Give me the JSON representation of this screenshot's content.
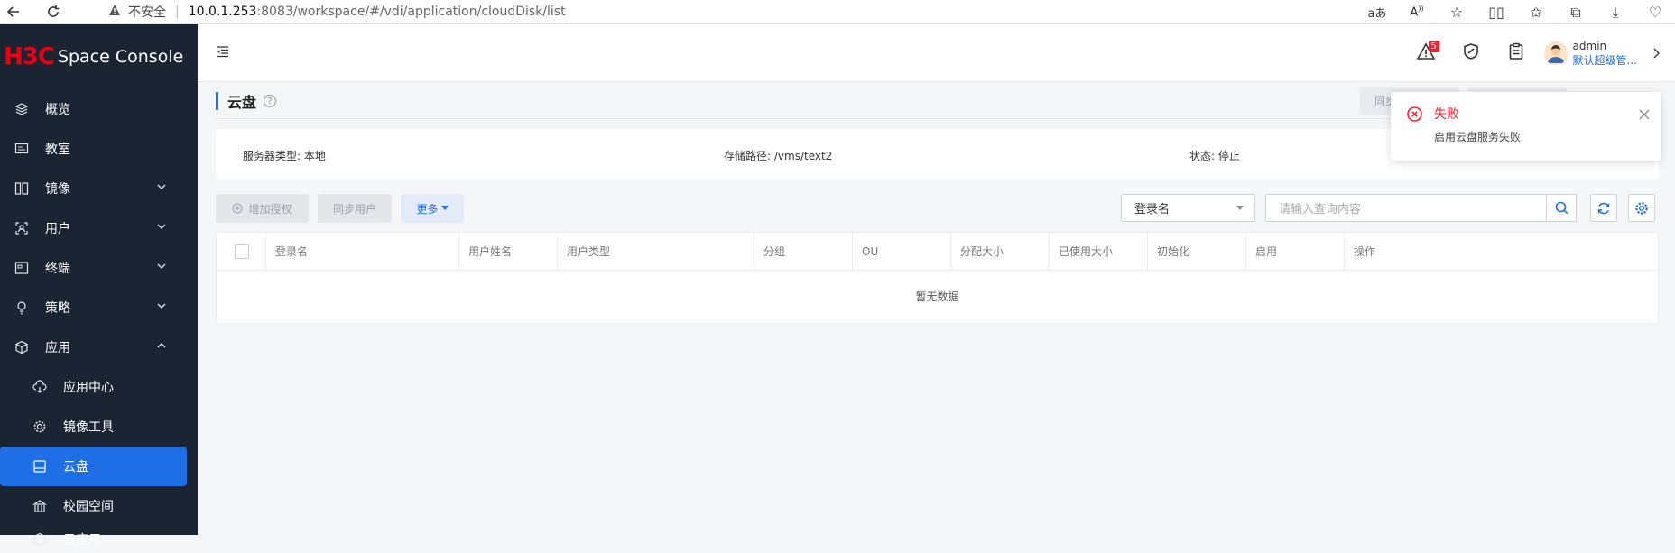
{
  "browser": {
    "insecure_label": "不安全",
    "url_host": "10.0.1.253",
    "url_rest": ":8083/workspace/#/vdi/application/cloudDisk/list"
  },
  "app": {
    "brand": "H3C",
    "title": "Space Console"
  },
  "sidebar": {
    "items": [
      {
        "label": "概览",
        "icon": "layers-icon"
      },
      {
        "label": "教室",
        "icon": "classroom-icon"
      },
      {
        "label": "镜像",
        "icon": "image-icon"
      },
      {
        "label": "用户",
        "icon": "user-icon"
      },
      {
        "label": "终端",
        "icon": "terminal-icon"
      },
      {
        "label": "策略",
        "icon": "policy-icon"
      },
      {
        "label": "应用",
        "icon": "app-icon"
      }
    ],
    "subitems": [
      {
        "label": "应用中心",
        "icon": "app-center-icon"
      },
      {
        "label": "镜像工具",
        "icon": "gear-icon"
      },
      {
        "label": "云盘",
        "icon": "cloud-disk-icon"
      },
      {
        "label": "校园空间",
        "icon": "campus-icon"
      },
      {
        "label": "云应用",
        "icon": "cloud-app-icon"
      }
    ]
  },
  "header": {
    "alert_count": "5",
    "user_name": "admin",
    "user_role": "默认超级管..."
  },
  "page": {
    "title": "云盘",
    "ghost_btn_label": "同步"
  },
  "info": {
    "server_type": "服务器类型: 本地",
    "storage_path": "存储路径: /vms/text2",
    "status": "状态: 停止"
  },
  "toolbar": {
    "add_auth": "增加授权",
    "sync_users": "同步用户",
    "more": "更多",
    "select_value": "登录名",
    "search_placeholder": "请输入查询内容"
  },
  "table": {
    "columns": [
      "登录名",
      "用户姓名",
      "用户类型",
      "分组",
      "OU",
      "分配大小",
      "已使用大小",
      "初始化",
      "启用",
      "操作"
    ],
    "empty_text": "暂无数据"
  },
  "notification": {
    "title": "失败",
    "message": "启用云盘服务失败"
  },
  "colors": {
    "sidebar_bg": "#1a2433",
    "accent": "#1e6fe6",
    "error": "#f5222d"
  }
}
